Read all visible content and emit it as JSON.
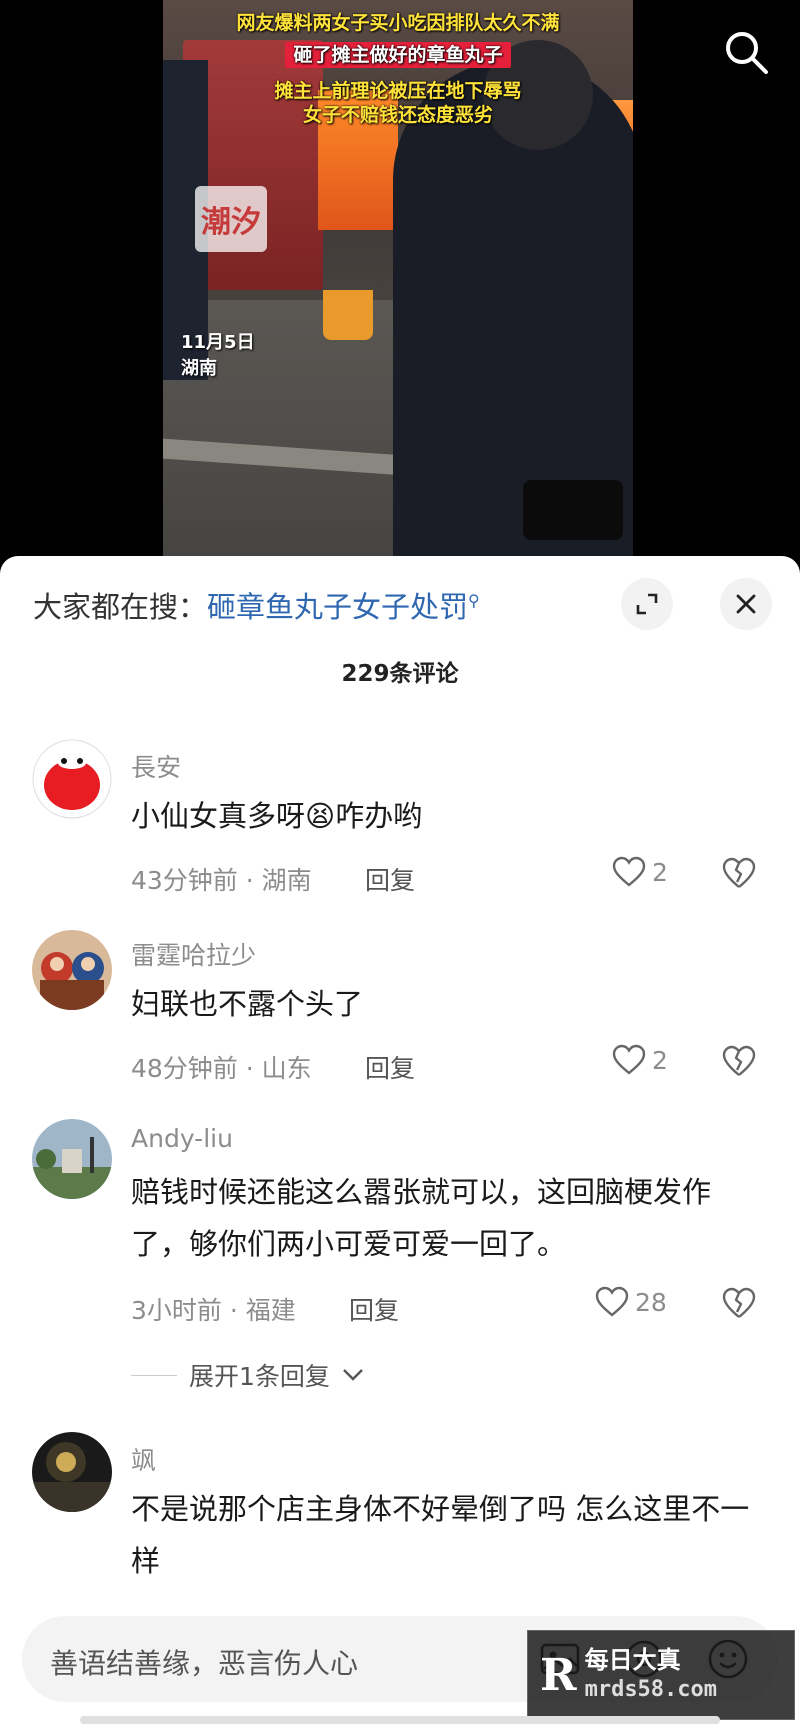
{
  "video": {
    "caption_line1": "网友爆料两女子买小吃因排队太久不满",
    "caption_line2": "砸了摊主做好的章鱼丸子",
    "caption_line3": "摊主上前理论被压在地下辱骂",
    "caption_line4": "女子不赔钱还态度恶劣",
    "logo": "潮汐",
    "date": "11月5日",
    "location": "湖南",
    "search_icon": "search-icon"
  },
  "sheet": {
    "search_prefix": "大家都在搜：",
    "search_query": "砸章鱼丸子女子处罚",
    "comment_count": "229条评论"
  },
  "comments": [
    {
      "name": "長安",
      "text_before": "小仙女真多呀",
      "emoji": "😫",
      "text_after": "咋办哟",
      "meta": "43分钟前 · 湖南",
      "reply": "回复",
      "likes": "2"
    },
    {
      "name": "雷霆哈拉少",
      "text": "妇联也不露个头了",
      "meta": "48分钟前 · 山东",
      "reply": "回复",
      "likes": "2"
    },
    {
      "name": "Andy-liu",
      "text": "赔钱时候还能这么嚣张就可以，这回脑梗发作了，够你们两小可爱可爱一回了。",
      "meta": "3小时前 · 福建",
      "reply": "回复",
      "likes": "28",
      "expand": "展开1条回复"
    },
    {
      "name": "飒",
      "text": "不是说那个店主身体不好晕倒了吗 怎么这里不一样"
    }
  ],
  "input": {
    "placeholder": "善语结善缘，恶言伤人心"
  },
  "watermark": {
    "top": "每日大真",
    "bottom": "mrds58.com"
  },
  "colors": {
    "link": "#2f67b0",
    "caption_yellow": "#ffe23a",
    "caption_red": "#e5203a"
  }
}
